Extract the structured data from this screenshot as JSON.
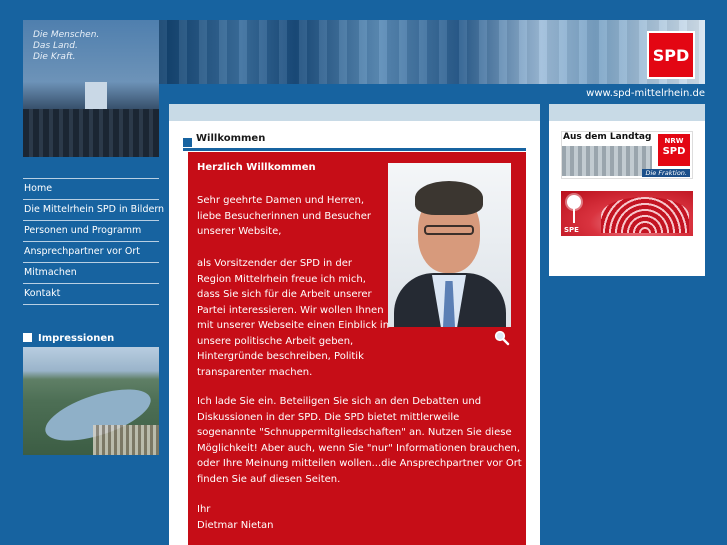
{
  "header": {
    "slogan": [
      "Die Menschen.",
      "Das Land.",
      "Die Kraft."
    ],
    "logo_text": "SPD",
    "site_url": "www.spd-mittelrhein.de"
  },
  "nav": {
    "items": [
      {
        "label": "Home"
      },
      {
        "label": "Die Mittelrhein SPD in Bildern"
      },
      {
        "label": "Personen und Programm"
      },
      {
        "label": "Ansprechpartner vor Ort"
      },
      {
        "label": "Mitmachen"
      },
      {
        "label": "Kontakt"
      }
    ]
  },
  "impressionen": {
    "heading": "Impressionen"
  },
  "main": {
    "section_heading": "Willkommen",
    "content_title": "Herzlich Willkommen",
    "greeting": [
      "Sehr geehrte Damen und Herren,",
      "liebe Besucherinnen und Besucher",
      "unserer Website,"
    ],
    "para1": [
      "als Vorsitzender der SPD in der",
      "Region Mittelrhein freue ich mich,",
      "dass Sie sich für die Arbeit unserer",
      "Partei interessieren. Wir wollen Ihnen",
      "mit unserer Webseite einen Einblick in",
      "unsere politische Arbeit geben,",
      "Hintergründe beschreiben, Politik",
      "transparenter machen."
    ],
    "para2": [
      "Ich lade Sie ein. Beteiligen Sie sich an den Debatten und",
      "Diskussionen in der SPD. Die SPD bietet mittlerweile",
      "sogenannte \"Schnuppermitgliedschaften\" an. Nutzen Sie diese",
      "Möglichkeit! Aber auch, wenn Sie \"nur\" Informationen brauchen,",
      "oder Ihre Meinung mitteilen wollen...die Ansprechpartner vor Ort",
      "finden Sie auf diesen Seiten."
    ],
    "closing": [
      "Ihr",
      "Dietmar Nietan"
    ]
  },
  "sidebar_right": {
    "landtag_title": "Aus dem Landtag",
    "landtag_badge_top": "NRW",
    "landtag_badge_bottom": "SPD",
    "landtag_caption": "Die Fraktion.",
    "spe_label": "SPE"
  },
  "colors": {
    "background": "#1763a0",
    "accent_red": "#c60d17",
    "spd_red": "#e30613"
  },
  "icons": {
    "zoom": "magnifier-icon"
  }
}
